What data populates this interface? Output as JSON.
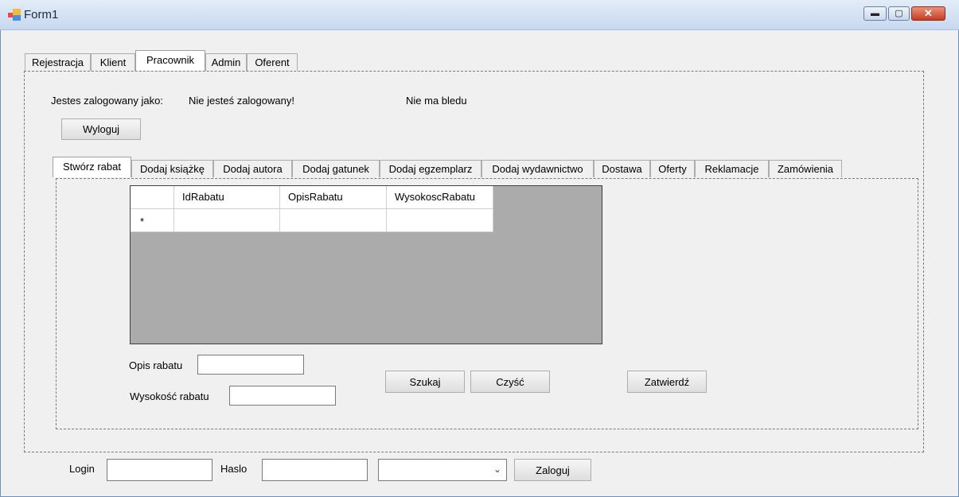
{
  "window": {
    "title": "Form1"
  },
  "main_tabs": [
    {
      "label": "Rejestracja"
    },
    {
      "label": "Klient"
    },
    {
      "label": "Pracownik"
    },
    {
      "label": "Admin"
    },
    {
      "label": "Oferent"
    }
  ],
  "status": {
    "logged_as_label": "Jestes zalogowany jako:",
    "logged_as_value": "Nie jesteś zalogowany!",
    "error_text": "Nie ma bledu",
    "logout_button": "Wyloguj"
  },
  "sub_tabs": [
    {
      "label": "Stwórz rabat"
    },
    {
      "label": "Dodaj książkę"
    },
    {
      "label": "Dodaj autora"
    },
    {
      "label": "Dodaj gatunek"
    },
    {
      "label": "Dodaj egzemplarz"
    },
    {
      "label": "Dodaj wydawnictwo"
    },
    {
      "label": "Dostawa"
    },
    {
      "label": "Oferty"
    },
    {
      "label": "Reklamacje"
    },
    {
      "label": "Zamówienia"
    }
  ],
  "grid": {
    "columns": [
      "IdRabatu",
      "OpisRabatu",
      "WysokoscRabatu"
    ],
    "new_row_marker": "*"
  },
  "form": {
    "opis_label": "Opis rabatu",
    "opis_value": "",
    "wysokosc_label": "Wysokość rabatu",
    "wysokosc_value": "",
    "search_button": "Szukaj",
    "clear_button": "Czyść",
    "confirm_button": "Zatwierdź"
  },
  "login": {
    "login_label": "Login",
    "login_value": "",
    "password_label": "Haslo",
    "password_value": "",
    "combo_value": "",
    "login_button": "Zaloguj"
  }
}
